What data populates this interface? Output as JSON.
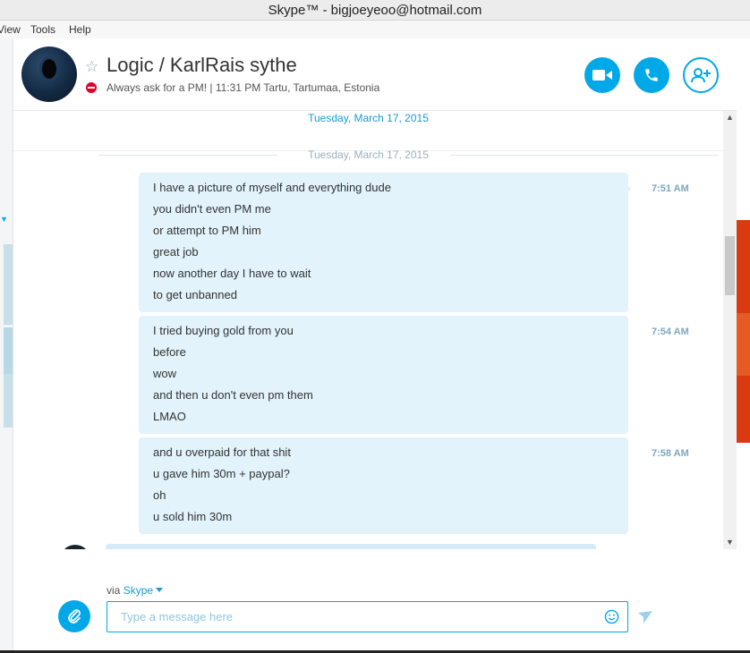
{
  "window": {
    "title": "Skype™ - bigjoeyeoo@hotmail.com"
  },
  "menu": [
    "View",
    "Tools",
    "Help"
  ],
  "contact": {
    "name": "Logic /  KarlRais sythe",
    "mood": "Always ask for a PM!  |  11:31 PM Tartu, Tartumaa, Estonia"
  },
  "header_buttons": {
    "video_icon": "video-camera-icon",
    "call_icon": "phone-icon",
    "add_icon": "add-person-icon"
  },
  "conversation": {
    "date_top": "Tuesday, March 17, 2015",
    "date_separator": "Tuesday, March 17, 2015",
    "messages": [
      {
        "time": "7:51 AM",
        "lines": [
          "I have a picture of myself and everything dude",
          "you didn't even PM me",
          "or attempt to PM him",
          "great job",
          "now another day I have to wait",
          "to get unbanned"
        ]
      },
      {
        "time": "7:54 AM",
        "lines": [
          "I tried buying gold from you",
          "before",
          "wow",
          "and then u don't even pm them",
          "LMAO"
        ]
      },
      {
        "time": "7:58 AM",
        "lines": [
          "and u overpaid for that shit",
          "u gave him 30m + paypal?",
          "oh",
          "u sold him 30m"
        ]
      }
    ]
  },
  "composer": {
    "via_label": "via",
    "via_service": "Skype",
    "placeholder": "Type a message here"
  },
  "colors": {
    "accent": "#00a8e8",
    "bubble": "#e2f3fb",
    "status_dnd": "#e4002b"
  }
}
